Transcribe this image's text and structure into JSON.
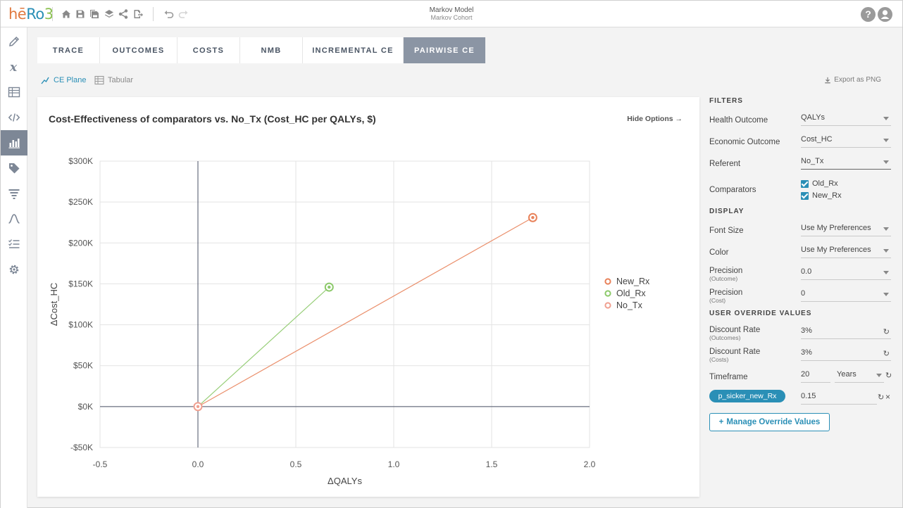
{
  "app": {
    "logo": {
      "part1": "hē",
      "part2": "Ro",
      "part3": "3"
    },
    "title": "Markov Model",
    "subtitle": "Markov Cohort",
    "help_label": "?"
  },
  "toolbar_icons": [
    "home-icon",
    "save-icon",
    "save-as-icon",
    "layers-icon",
    "share-icon",
    "export-icon",
    "undo-icon",
    "redo-icon"
  ],
  "sidebar": {
    "items": [
      {
        "name": "pencil-icon"
      },
      {
        "name": "variable-x-icon"
      },
      {
        "name": "table-icon"
      },
      {
        "name": "code-icon"
      },
      {
        "name": "bar-chart-icon",
        "active": true
      },
      {
        "name": "tag-icon"
      },
      {
        "name": "filter-icon"
      },
      {
        "name": "distribution-curve-icon"
      },
      {
        "name": "checklist-icon"
      },
      {
        "name": "gear-icon"
      }
    ]
  },
  "tabs": [
    {
      "label": "TRACE"
    },
    {
      "label": "OUTCOMES"
    },
    {
      "label": "COSTS"
    },
    {
      "label": "NMB"
    },
    {
      "label": "INCREMENTAL CE"
    },
    {
      "label": "PAIRWISE CE",
      "active": true
    }
  ],
  "views": {
    "ce_plane": "CE Plane",
    "tabular": "Tabular",
    "export": "Export as PNG"
  },
  "chart_card": {
    "title": "Cost-Effectiveness of comparators vs. No_Tx (Cost_HC per QALYs, $)",
    "hide_options": "Hide Options"
  },
  "chart_data": {
    "type": "scatter",
    "title": "Cost-Effectiveness of comparators vs. No_Tx (Cost_HC per QALYs, $)",
    "xlabel": "ΔQALYs",
    "ylabel": "ΔCost_HC",
    "xlim": [
      -0.5,
      2.0
    ],
    "ylim": [
      -50000,
      300000
    ],
    "x_ticks": [
      -0.5,
      0.0,
      0.5,
      1.0,
      1.5,
      2.0
    ],
    "x_tick_labels": [
      "-0.5",
      "0.0",
      "0.5",
      "1.0",
      "1.5",
      "2.0"
    ],
    "y_ticks": [
      -50000,
      0,
      50000,
      100000,
      150000,
      200000,
      250000,
      300000
    ],
    "y_tick_labels": [
      "-$50K",
      "$0K",
      "$50K",
      "$100K",
      "$150K",
      "$200K",
      "$250K",
      "$300K"
    ],
    "grid": true,
    "legend_position": "right",
    "series": [
      {
        "name": "New_Rx",
        "color": "#e8825a",
        "x": 1.71,
        "y": 231000
      },
      {
        "name": "Old_Rx",
        "color": "#8cc96a",
        "x": 0.67,
        "y": 146000
      },
      {
        "name": "No_Tx",
        "color": "#f0a090",
        "x": 0.0,
        "y": 0
      }
    ],
    "lines_from_origin": true
  },
  "filters": {
    "header": "FILTERS",
    "health_outcome": {
      "label": "Health Outcome",
      "value": "QALYs"
    },
    "economic_outcome": {
      "label": "Economic Outcome",
      "value": "Cost_HC"
    },
    "referent": {
      "label": "Referent",
      "value": "No_Tx"
    },
    "comparators": {
      "label": "Comparators",
      "items": [
        "Old_Rx",
        "New_Rx"
      ]
    }
  },
  "display": {
    "header": "DISPLAY",
    "font_size": {
      "label": "Font Size",
      "value": "Use My Preferences"
    },
    "color": {
      "label": "Color",
      "value": "Use My Preferences"
    },
    "precision_outcome": {
      "label": "Precision",
      "sub": "(Outcome)",
      "value": "0.0"
    },
    "precision_cost": {
      "label": "Precision",
      "sub": "(Cost)",
      "value": "0"
    }
  },
  "overrides": {
    "header": "USER OVERRIDE VALUES",
    "discount_outcomes": {
      "label": "Discount Rate",
      "sub": "(Outcomes)",
      "value": "3%"
    },
    "discount_costs": {
      "label": "Discount Rate",
      "sub": "(Costs)",
      "value": "3%"
    },
    "timeframe": {
      "label": "Timeframe",
      "value": "20",
      "unit": "Years"
    },
    "param": {
      "name": "p_sicker_new_Rx",
      "value": "0.15"
    },
    "manage_button": "Manage Override Values"
  },
  "colors": {
    "accent": "#2a8fb6",
    "active_tab": "#8b95a4",
    "new_rx": "#e8825a",
    "old_rx": "#8cc96a",
    "no_tx": "#f0a090"
  }
}
